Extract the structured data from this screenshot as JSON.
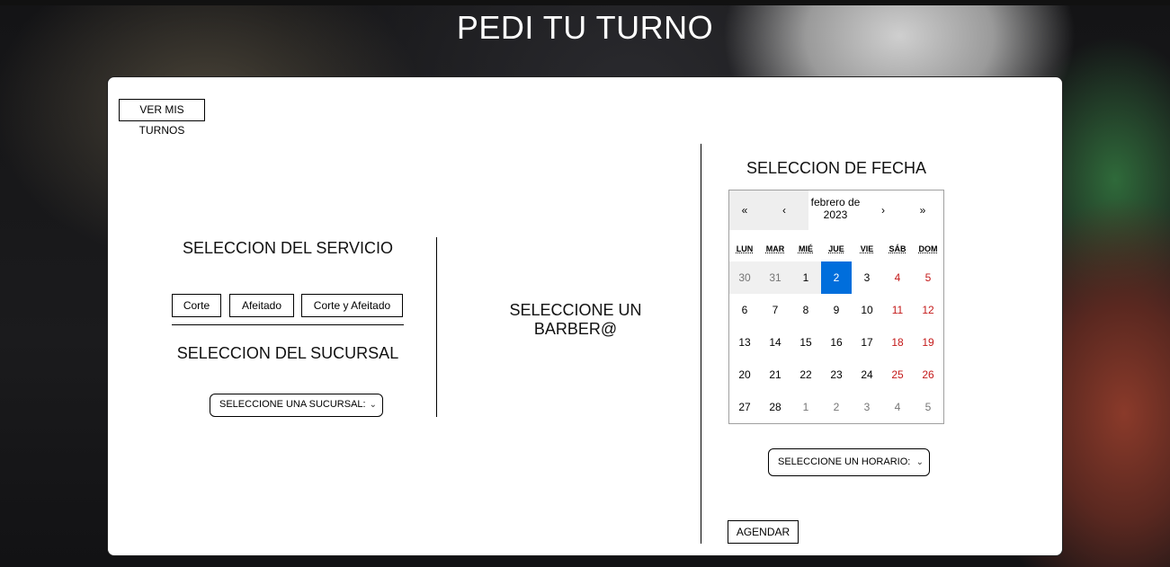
{
  "header": {
    "title": "PEDI TU TURNO"
  },
  "card": {
    "ver_turnos_label": "VER MIS TURNOS",
    "servicio": {
      "title": "SELECCION DEL SERVICIO",
      "options": [
        "Corte",
        "Afeitado",
        "Corte y Afeitado"
      ]
    },
    "sucursal": {
      "title": "SELECCION DEL SUCURSAL",
      "select_value": "SELECCIONE UNA SUCURSAL:"
    },
    "barber": {
      "title": "SELECCIONE UN BARBER@"
    },
    "fecha": {
      "title": "SELECCION DE FECHA",
      "calendar": {
        "nav_prev2": "«",
        "nav_prev": "‹",
        "month_label": "febrero de 2023",
        "nav_next": "›",
        "nav_next2": "»",
        "weekdays": [
          "LUN",
          "MAR",
          "MIÉ",
          "JUE",
          "VIE",
          "SÁB",
          "DOM"
        ],
        "weeks": [
          [
            "30",
            "31",
            "1",
            "2",
            "3",
            "4",
            "5"
          ],
          [
            "6",
            "7",
            "8",
            "9",
            "10",
            "11",
            "12"
          ],
          [
            "13",
            "14",
            "15",
            "16",
            "17",
            "18",
            "19"
          ],
          [
            "20",
            "21",
            "22",
            "23",
            "24",
            "25",
            "26"
          ],
          [
            "27",
            "28",
            "1",
            "2",
            "3",
            "4",
            "5"
          ]
        ],
        "selected_day": "2"
      },
      "horario_select_value": "SELECCIONE UN HORARIO:"
    },
    "agendar_label": "AGENDAR"
  },
  "colors": {
    "selected_day": "#006edc",
    "weekend_day": "#c41a1a",
    "other_month_day": "#757575"
  }
}
